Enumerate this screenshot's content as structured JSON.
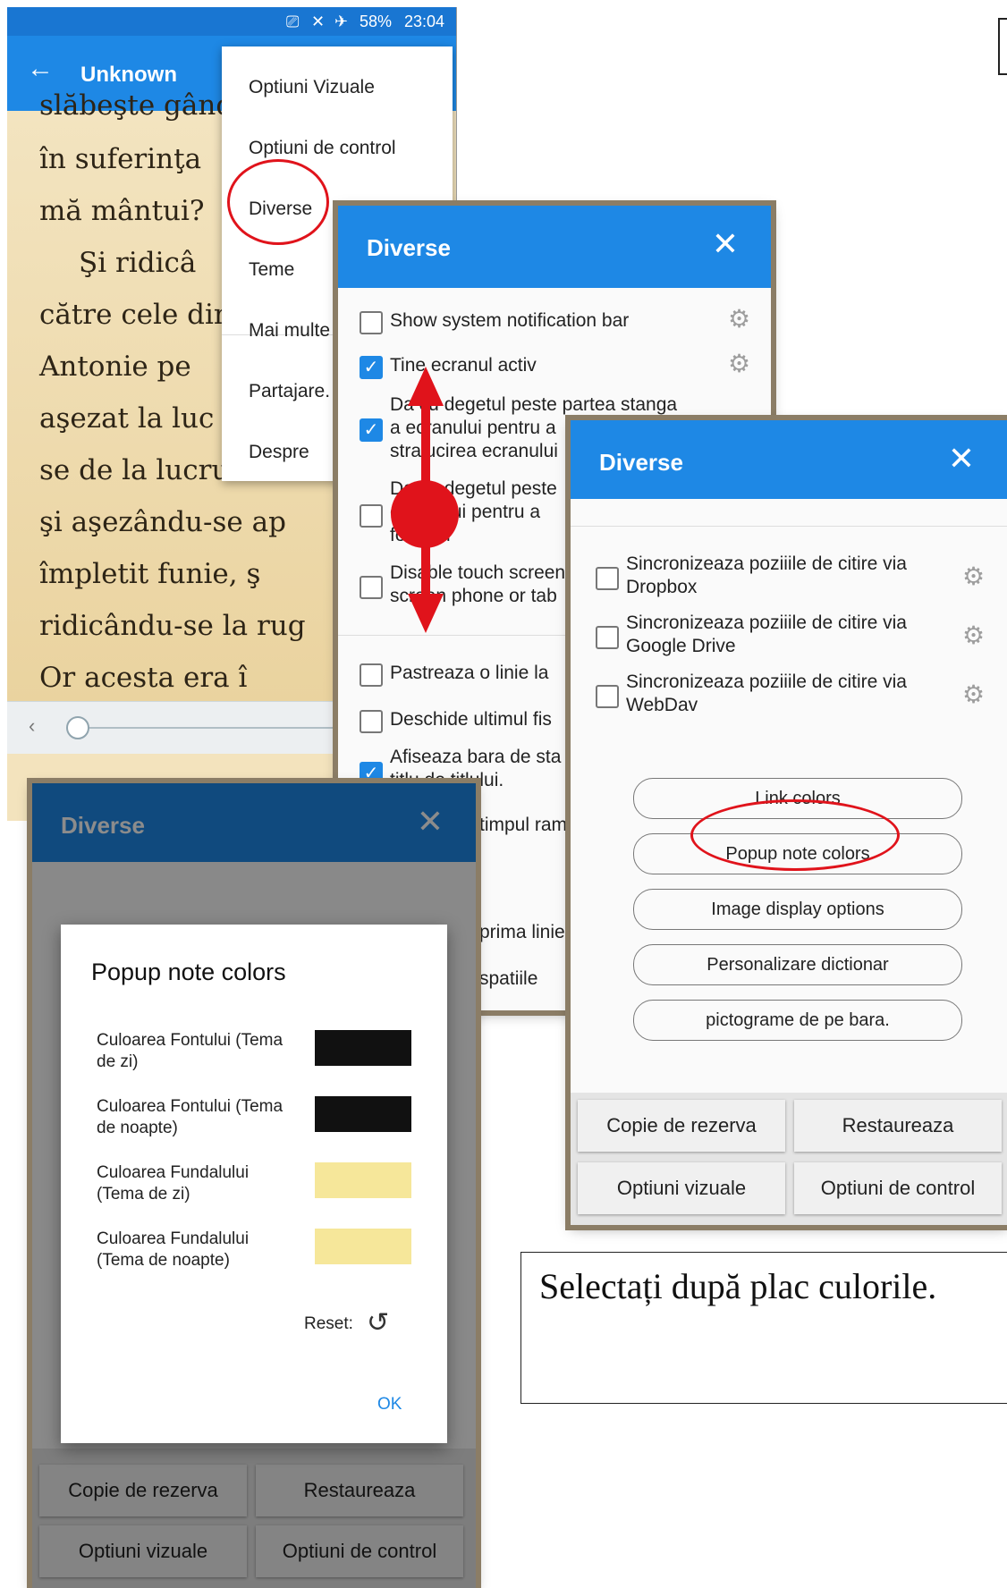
{
  "reader": {
    "status": {
      "battery": "58%",
      "time": "23:04"
    },
    "title": "Unknown",
    "lines": [
      "slăbeşte gând",
      "în suferinţa",
      "mă mântui?",
      "Şi    ridicâ",
      "către cele din",
      "Antonie    pe",
      "aşezat la luc",
      "se de la lucru",
      "şi   aşezându-se    ap",
      "împletit    funie,    ş",
      "ridicându-se la rug",
      "Or    acesta    era    î"
    ]
  },
  "menu": {
    "items": [
      "Optiuni Vizuale",
      "Optiuni de control",
      "Diverse",
      "Teme",
      "Mai multe",
      "Partajare.",
      "Despre"
    ]
  },
  "dialog_main": {
    "title": "Diverse",
    "options": [
      {
        "label": "Show system notification bar",
        "checked": false
      },
      {
        "label": "Tine ecranul activ",
        "checked": true
      },
      {
        "label": "Da cu degetul peste partea stanga",
        "label2": "a ecranului pentru a",
        "label3": "stralucirea ecranului",
        "checked": true
      },
      {
        "label": "Da cu degetul peste",
        "label2": "ecranului pentru a",
        "label3": "fontului",
        "checked": false
      },
      {
        "label": "Disable touch screen",
        "label2": "screen phone or tab",
        "checked": false
      },
      {
        "label": "Pastreaza o linie la",
        "checked": false
      },
      {
        "label": "Deschide ultimul fis",
        "checked": false
      },
      {
        "label": "Afiseaza bara de sta",
        "label2": "titlu de titlului.",
        "checked": true
      },
      {
        "label": "timpul ram"
      },
      {
        "label": "prima linie"
      },
      {
        "label": "spatiile"
      }
    ]
  },
  "dialog_sync": {
    "title": "Diverse",
    "sync": [
      {
        "l1": "Sincronizeaza poziiile de citire via",
        "l2": "Dropbox"
      },
      {
        "l1": "Sincronizeaza poziiile de citire via",
        "l2": "Google Drive"
      },
      {
        "l1": "Sincronizeaza poziiile de citire via",
        "l2": "WebDav"
      }
    ],
    "buttons": [
      "Link colors",
      "Popup note colors",
      "Image display options",
      "Personalizare dictionar",
      "pictograme de pe bara."
    ],
    "footer": [
      "Copie de rezerva",
      "Restaureaza",
      "Optiuni vizuale",
      "Optiuni de control"
    ]
  },
  "dialog_popup": {
    "title": "Diverse",
    "popup_title": "Popup note colors",
    "colors": [
      {
        "label": "Culoarea Fontului (Tema de zi)",
        "color": "#111111"
      },
      {
        "label": "Culoarea Fontului (Tema de noapte)",
        "color": "#111111"
      },
      {
        "label": "Culoarea Fundalului (Tema de zi)",
        "color": "#f6e79a"
      },
      {
        "label": "Culoarea Fundalului (Tema de noapte)",
        "color": "#f6e79a"
      }
    ],
    "reset": "Reset:",
    "ok": "OK",
    "footer": [
      "Copie de rezerva",
      "Restaureaza",
      "Optiuni vizuale",
      "Optiuni de control"
    ]
  },
  "caption": "Selectați după plac culorile.",
  "accent": "#1e88e5",
  "highlight": "#e0131b"
}
